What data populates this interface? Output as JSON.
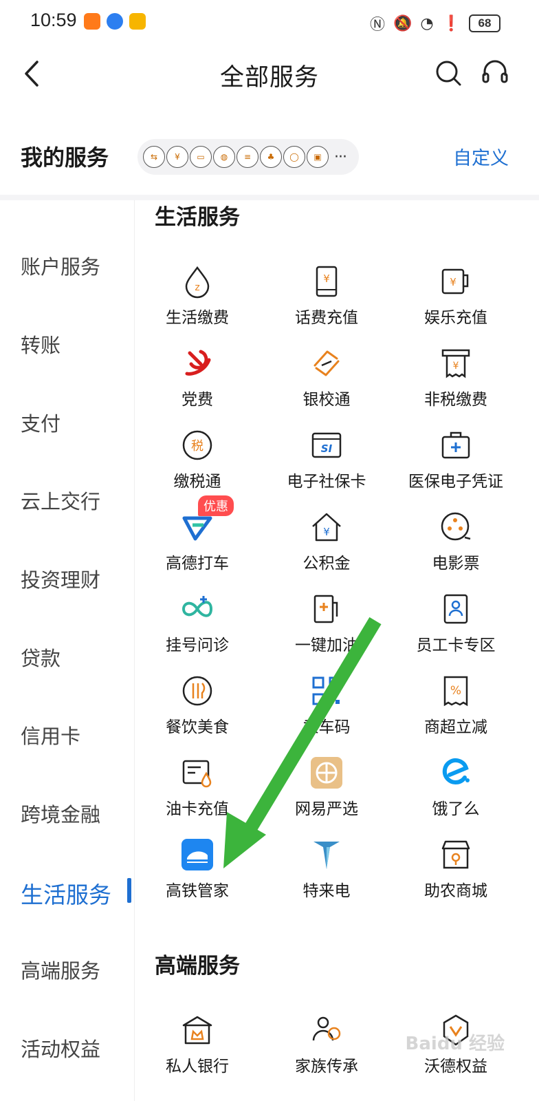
{
  "status_bar": {
    "time": "10:59",
    "battery": "68",
    "app_icon_colors": [
      "#ff7a1a",
      "#2d7ff0",
      "#f7b500"
    ]
  },
  "header": {
    "title": "全部服务",
    "icons": [
      "back-arrow",
      "search-icon",
      "customer-service-icon"
    ]
  },
  "my_services": {
    "title": "我的服务",
    "customize": "自定义",
    "more": "···"
  },
  "sidebar": {
    "items": [
      {
        "label": "账户服务"
      },
      {
        "label": "转账"
      },
      {
        "label": "支付"
      },
      {
        "label": "云上交行"
      },
      {
        "label": "投资理财"
      },
      {
        "label": "贷款"
      },
      {
        "label": "信用卡"
      },
      {
        "label": "跨境金融"
      },
      {
        "label": "生活服务",
        "active": true
      },
      {
        "label": "高端服务"
      },
      {
        "label": "活动权益"
      }
    ]
  },
  "life_services": {
    "title": "生活服务",
    "badge": "优惠",
    "items": [
      {
        "label": "生活缴费",
        "icon": "water-drop-icon"
      },
      {
        "label": "话费充值",
        "icon": "phone-yuan-icon"
      },
      {
        "label": "娱乐充值",
        "icon": "mug-yuan-icon"
      },
      {
        "label": "党费",
        "icon": "party-emblem-icon"
      },
      {
        "label": "银校通",
        "icon": "link-icon"
      },
      {
        "label": "非税缴费",
        "icon": "receipt-icon"
      },
      {
        "label": "缴税通",
        "icon": "tax-icon"
      },
      {
        "label": "电子社保卡",
        "icon": "si-card-icon"
      },
      {
        "label": "医保电子凭证",
        "icon": "medical-kit-icon"
      },
      {
        "label": "高德打车",
        "icon": "amap-logo-icon"
      },
      {
        "label": "公积金",
        "icon": "house-yuan-icon"
      },
      {
        "label": "电影票",
        "icon": "film-reel-icon"
      },
      {
        "label": "挂号问诊",
        "icon": "health-icon"
      },
      {
        "label": "一键加油",
        "icon": "fuel-pump-icon"
      },
      {
        "label": "员工卡专区",
        "icon": "badge-card-icon"
      },
      {
        "label": "餐饮美食",
        "icon": "dining-icon"
      },
      {
        "label": "乘车码",
        "icon": "qr-code-icon"
      },
      {
        "label": "商超立减",
        "icon": "discount-tag-icon"
      },
      {
        "label": "油卡充值",
        "icon": "fuel-card-icon"
      },
      {
        "label": "网易严选",
        "icon": "yanxuan-logo-icon"
      },
      {
        "label": "饿了么",
        "icon": "eleme-logo-icon"
      },
      {
        "label": "高铁管家",
        "icon": "train-logo-icon"
      },
      {
        "label": "特来电",
        "icon": "teld-logo-icon"
      },
      {
        "label": "助农商城",
        "icon": "shop-icon"
      }
    ]
  },
  "premium_services": {
    "title": "高端服务",
    "items": [
      {
        "label": "私人银行",
        "icon": "bank-crown-icon"
      },
      {
        "label": "家族传承",
        "icon": "family-icon"
      },
      {
        "label": "沃德权益",
        "icon": "diamond-icon"
      }
    ]
  },
  "watermark": "Baidu 经验",
  "colors": {
    "accent": "#1e6fd1",
    "icon_orange": "#e8821e",
    "annotation_arrow": "#3cb43c"
  }
}
